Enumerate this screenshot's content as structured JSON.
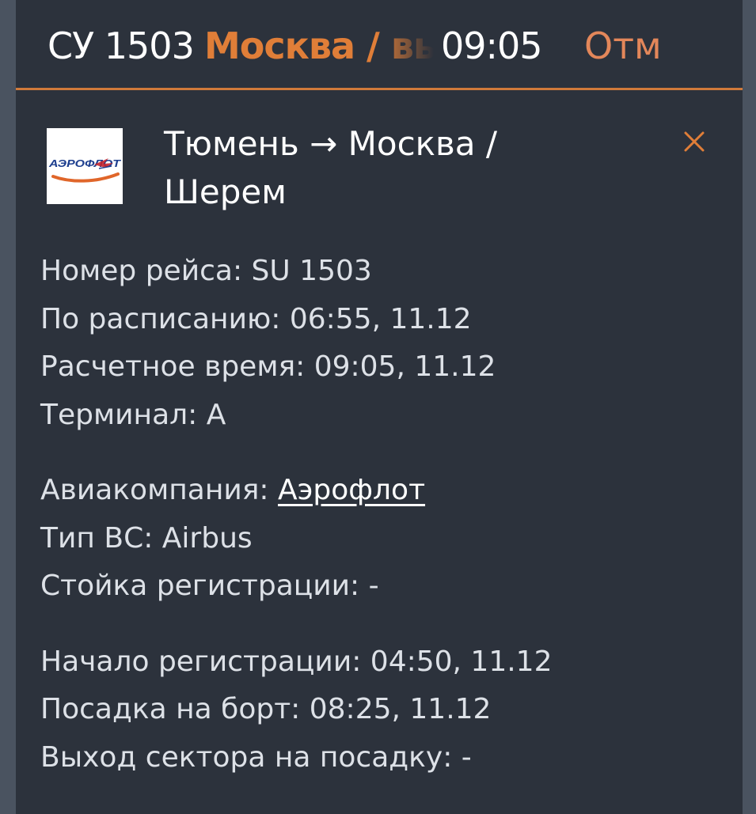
{
  "header": {
    "flight": "СУ 1503",
    "destination": "Москва / вы",
    "time": "09:05",
    "status": "Отм"
  },
  "card": {
    "logo_text": "АЭРОФЛОТ",
    "route_line1": "Тюмень → Москва /",
    "route_line2": "Шерем",
    "close_icon": "close-x-icon",
    "group1": [
      {
        "label": "Номер рейса: ",
        "value": "SU 1503"
      },
      {
        "label": "По расписанию: ",
        "value": "06:55, 11.12"
      },
      {
        "label": "Расчетное время: ",
        "value": "09:05, 11.12"
      },
      {
        "label": "Терминал: ",
        "value": "A"
      }
    ],
    "airline_label": "Авиакомпания: ",
    "airline_value": "Аэрофлот",
    "group2": [
      {
        "label": "Тип ВС: ",
        "value": "Airbus"
      },
      {
        "label": "Стойка регистрации: ",
        "value": "-"
      }
    ],
    "group3": [
      {
        "label": "Начало регистрации: ",
        "value": "04:50, 11.12"
      },
      {
        "label": "Посадка на борт: ",
        "value": "08:25, 11.12"
      },
      {
        "label": "Выход сектора на посадку: ",
        "value": "-"
      }
    ]
  },
  "colors": {
    "background": "#2c323c",
    "outer": "#4a5360",
    "accent": "#e07e38",
    "status": "#e3875a",
    "text": "#dde1e7"
  }
}
